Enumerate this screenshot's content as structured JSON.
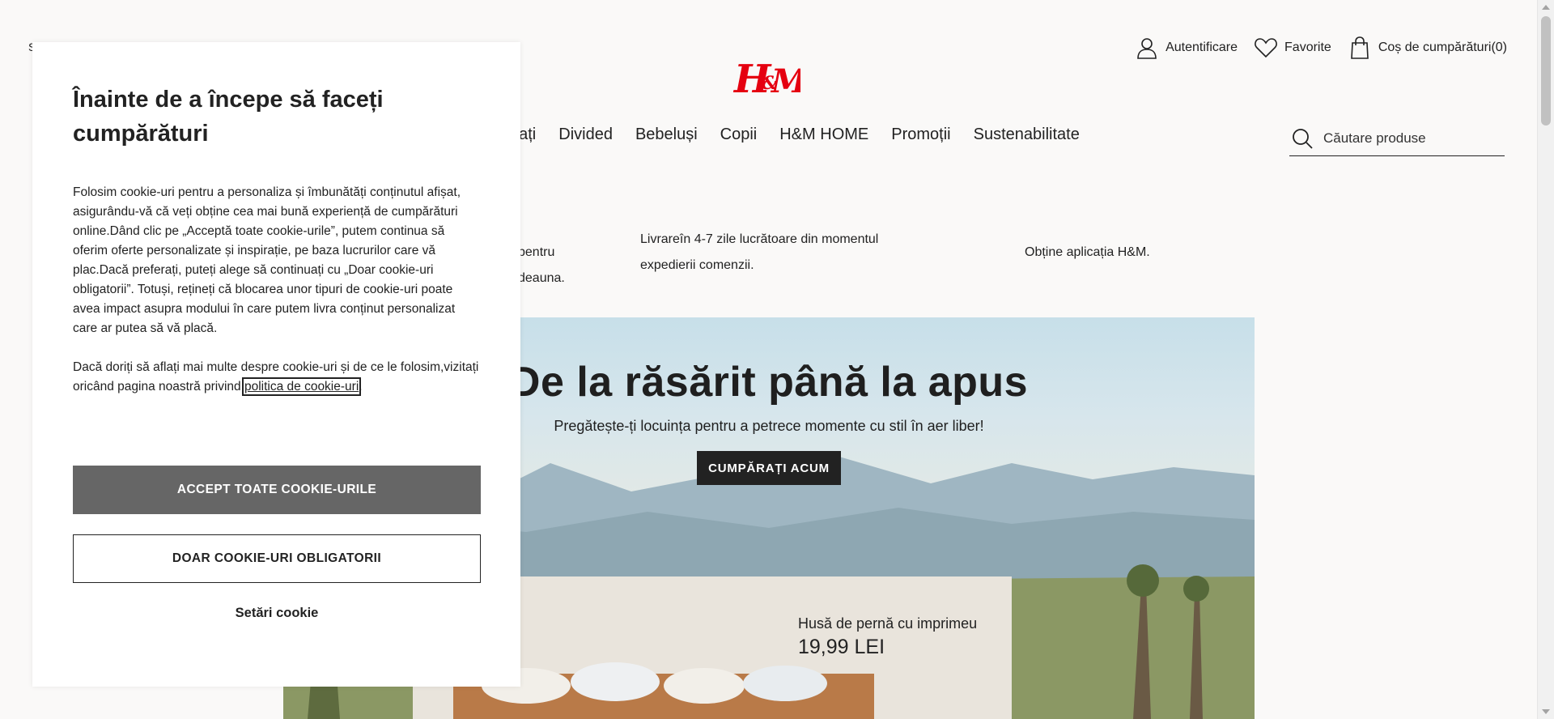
{
  "header": {
    "top_left_text": "S",
    "logo_text": "H&M",
    "account": {
      "login_label": "Autentificare",
      "favorites_label": "Favorite",
      "cart_label": "Coș de cumpărături(0)"
    },
    "nav": [
      "bați",
      "Divided",
      "Bebeluși",
      "Copii",
      "H&M HOME",
      "Promoții",
      "Sustenabilitate"
    ],
    "search": {
      "placeholder": "Căutare produse"
    }
  },
  "info_strip": {
    "item1": "pentru deauna.",
    "item2": "Livrareîn 4-7 zile lucrătoare din momentul expedierii comenzii.",
    "item3": "Obține aplicația H&M."
  },
  "hero": {
    "title": "De la răsărit până la apus",
    "subtitle": "Pregătește-ți locuința pentru a petrece momente cu stil în aer liber!",
    "cta": "CUMPĂRAȚI ACUM",
    "product_name": "Husă de pernă cu imprimeu",
    "product_price": "19,99 LEI"
  },
  "cookie_modal": {
    "title": "Înainte de a începe să faceți cumpărături",
    "paragraph1": "Folosim cookie-uri pentru a personaliza și îmbunătăți conținutul afișat, asigurându-vă că veți obține cea mai bună experiență de cumpărături online.Dând clic pe „Acceptă toate cookie-urile”, putem continua să oferim oferte personalizate și inspirație, pe baza lucrurilor care vă plac.Dacă preferați, puteți alege să continuați cu „Doar cookie-uri obligatorii”. Totuși, rețineți că blocarea unor tipuri de cookie-uri poate avea impact asupra modului în care putem livra conținut personalizat care ar putea să vă placă.",
    "paragraph2_prefix": "Dacă doriți să aflați mai multe despre cookie-uri și de ce le folosim,vizitați oricând pagina noastră privind ",
    "policy_link": "politica de cookie-uri",
    "paragraph2_suffix": ".",
    "accept_all": "ACCEPT TOATE COOKIE-URILE",
    "only_required": "DOAR COOKIE-URI OBLIGATORII",
    "settings": "Setări cookie"
  },
  "colors": {
    "brand_red": "#e50010",
    "accept_button": "#666666",
    "cta_background": "#222222"
  },
  "icons": [
    "user-icon",
    "heart-icon",
    "shopping-bag-icon",
    "search-icon"
  ]
}
